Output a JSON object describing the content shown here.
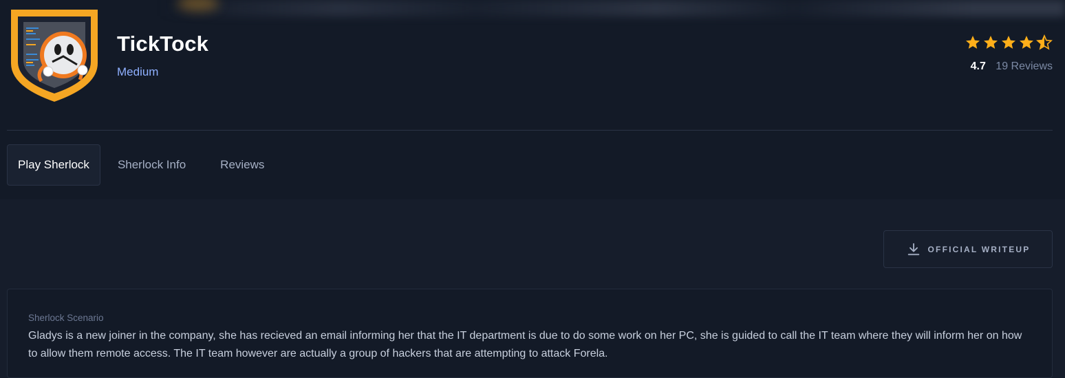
{
  "sherlock": {
    "title": "TickTock",
    "difficulty": "Medium",
    "logo_icon": "clock-mascot-shield-logo"
  },
  "rating": {
    "value": "4.7",
    "reviews": "19 Reviews",
    "stars": 4.5,
    "star_color": "#ffaf1a"
  },
  "tabs": [
    {
      "label": "Play Sherlock",
      "active": true
    },
    {
      "label": "Sherlock Info",
      "active": false
    },
    {
      "label": "Reviews",
      "active": false
    }
  ],
  "writeup_button": {
    "label": "OFFICIAL WRITEUP",
    "icon": "download-icon"
  },
  "scenario": {
    "heading": "Sherlock Scenario",
    "text": "Gladys is a new joiner in the company, she has recieved an email informing her that the IT department is due to do some work on her PC, she is guided to call the IT team where they will inform her on how to allow them remote access. The IT team however are actually a group of hackers that are attempting to attack Forela."
  },
  "colors": {
    "accent_blue": "#8fb0ff",
    "logo_orange": "#f5a623",
    "background": "#161d2b"
  }
}
